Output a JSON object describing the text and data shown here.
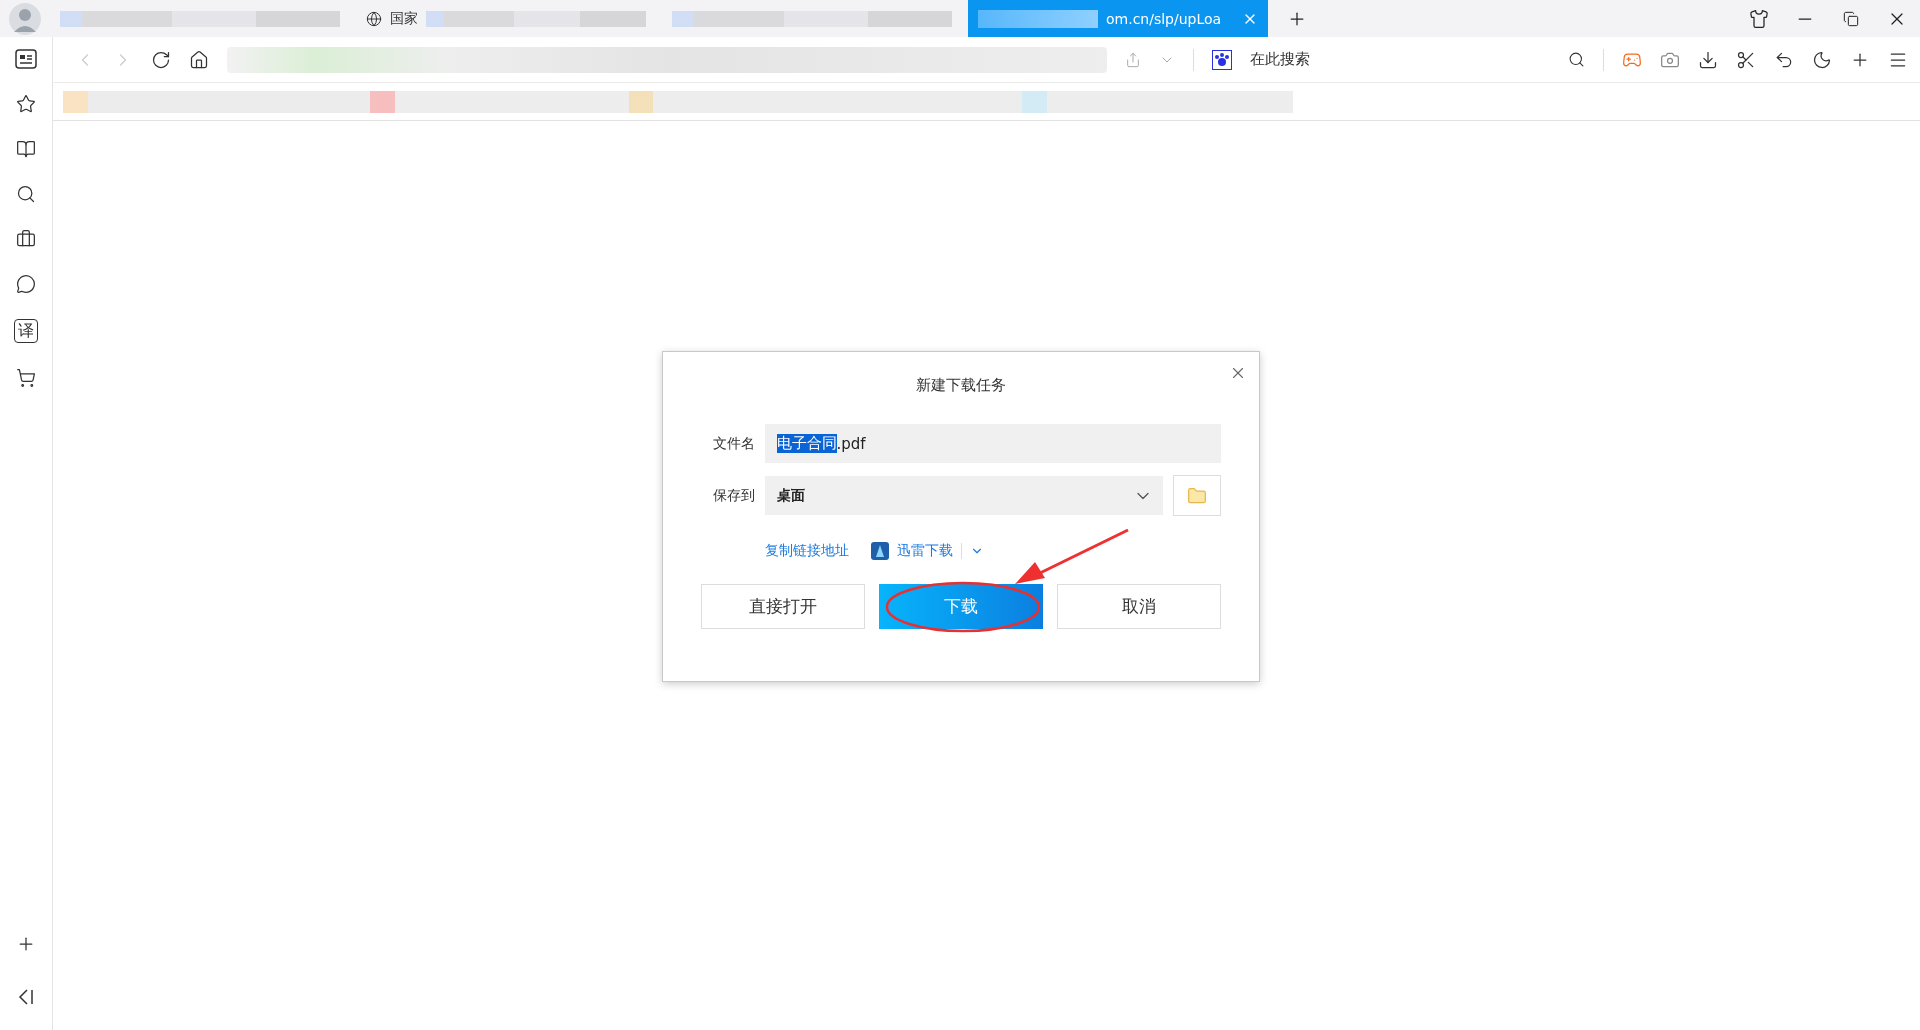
{
  "tabs": [
    {
      "kind": "blurred",
      "selected": false
    },
    {
      "kind": "page",
      "label": "国家",
      "selected": false
    },
    {
      "kind": "blurred",
      "selected": false
    },
    {
      "kind": "page",
      "label": "om.cn/slp/upLoa",
      "selected": true
    }
  ],
  "toolbar": {
    "search_placeholder": "在此搜索"
  },
  "sidebar": {
    "translate_glyph": "译"
  },
  "dialog": {
    "title": "新建下载任务",
    "filename": {
      "label": "文件名",
      "selected_text": "电子合同",
      "rest_text": ".pdf"
    },
    "save_to": {
      "label": "保存到",
      "value": "桌面"
    },
    "copy_link": "复制链接地址",
    "xunlei": "迅雷下载",
    "buttons": [
      {
        "kind": "plain",
        "label": "直接打开"
      },
      {
        "kind": "primary",
        "label": "下载"
      },
      {
        "kind": "plain",
        "label": "取消"
      }
    ]
  }
}
